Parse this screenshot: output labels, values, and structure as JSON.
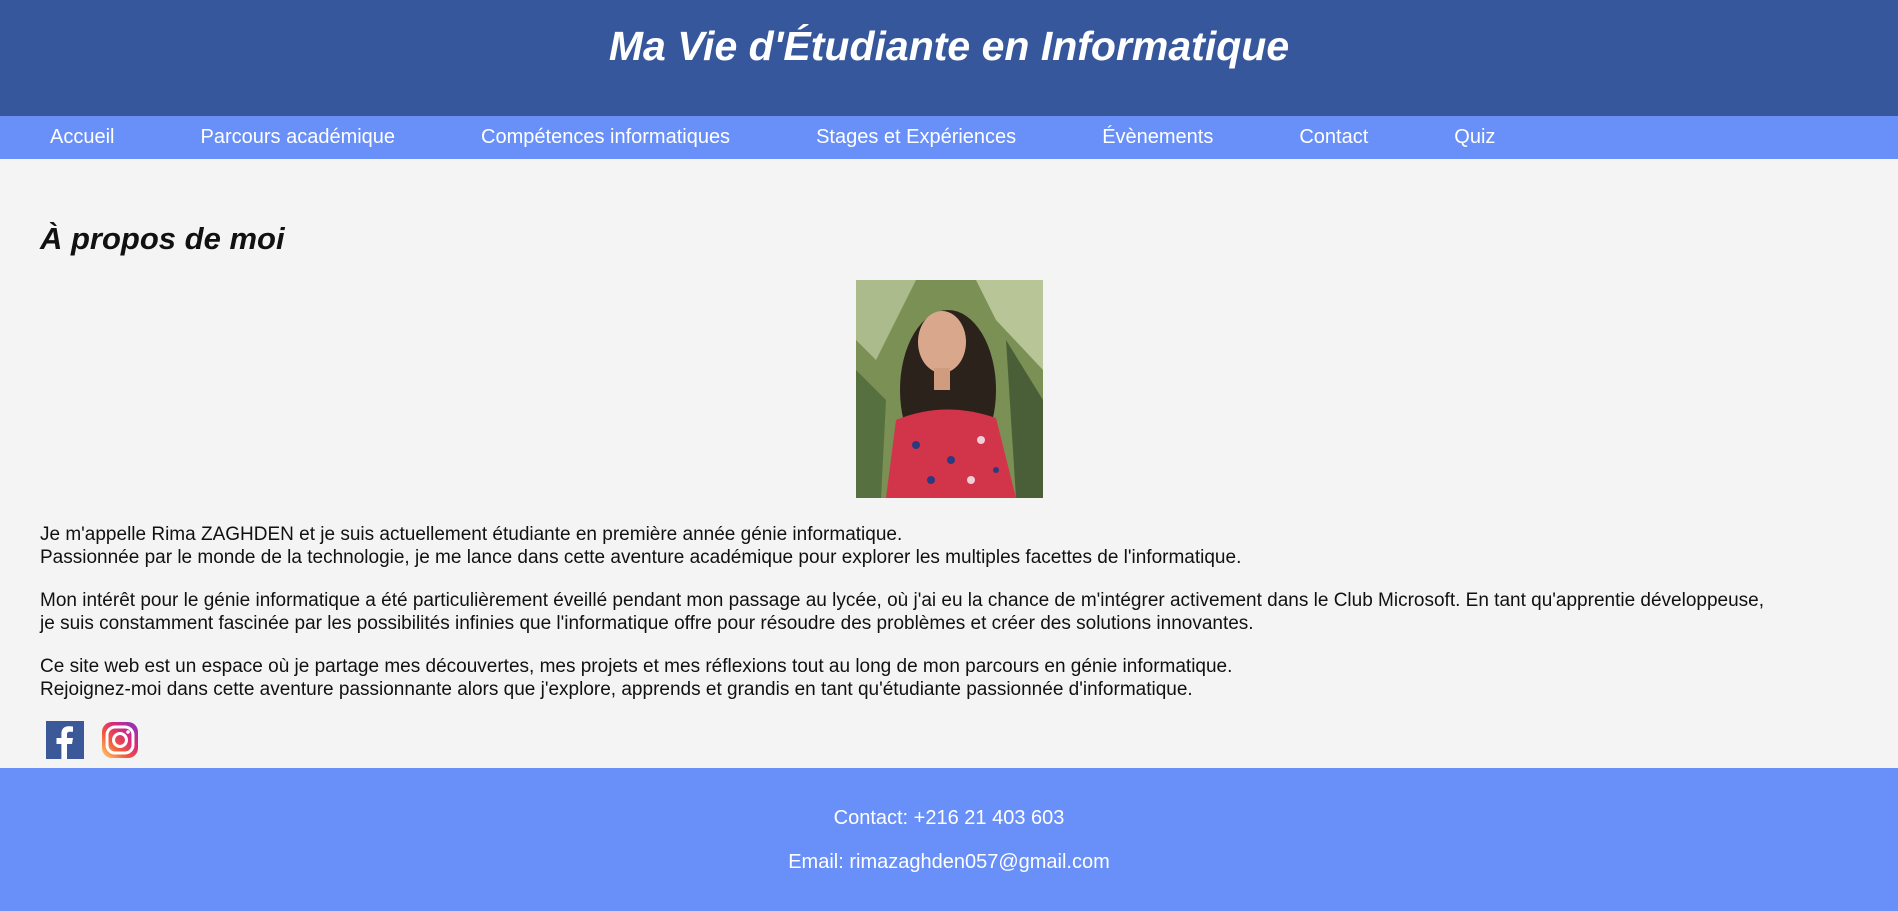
{
  "header": {
    "title": "Ma Vie d'Étudiante en Informatique"
  },
  "nav": {
    "items": [
      {
        "label": "Accueil"
      },
      {
        "label": "Parcours académique"
      },
      {
        "label": "Compétences informatiques"
      },
      {
        "label": "Stages et Expériences"
      },
      {
        "label": "Évènements"
      },
      {
        "label": "Contact"
      },
      {
        "label": "Quiz"
      }
    ]
  },
  "main": {
    "heading": "À propos de moi",
    "paragraphs": [
      {
        "line1": "Je m'appelle Rima ZAGHDEN et je suis actuellement étudiante en première année génie informatique.",
        "line2": "Passionnée par le monde de la technologie, je me lance dans cette aventure académique pour explorer les multiples facettes de l'informatique."
      },
      {
        "line1": "Mon intérêt pour le génie informatique a été particulièrement éveillé pendant mon passage au lycée, où j'ai eu la chance de m'intégrer activement dans le Club Microsoft. En tant qu'apprentie développeuse,",
        "line2": "je suis constamment fascinée par les possibilités infinies que l'informatique offre pour résoudre des problèmes et créer des solutions innovantes."
      },
      {
        "line1": "Ce site web est un espace où je partage mes découvertes, mes projets et mes réflexions tout au long de mon parcours en génie informatique.",
        "line2": "Rejoignez-moi dans cette aventure passionnante alors que j'explore, apprends et grandis en tant qu'étudiante passionnée d'informatique."
      }
    ],
    "socials": [
      {
        "icon": "facebook-icon"
      },
      {
        "icon": "instagram-icon"
      }
    ]
  },
  "footer": {
    "contact": "Contact: +216 21 403 603",
    "email": "Email: rimazaghden057@gmail.com"
  },
  "colors": {
    "header_bg": "#36579c",
    "nav_bg": "#6890f8",
    "page_bg": "#f4f4f4",
    "footer_bg": "#6890f8",
    "facebook": "#3b5998"
  }
}
